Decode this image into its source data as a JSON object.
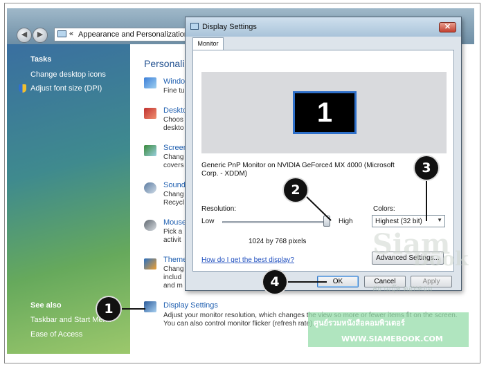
{
  "window": {
    "breadcrumb_chevron": "«",
    "breadcrumb": "Appearance and Personalization"
  },
  "sidebar": {
    "tasks_heading": "Tasks",
    "tasks": [
      "Change desktop icons",
      "Adjust font size (DPI)"
    ],
    "see_also_heading": "See also",
    "see_also": [
      "Taskbar and Start Menu",
      "Ease of Access"
    ]
  },
  "content": {
    "heading": "Personaliz",
    "items": [
      {
        "title": "Windo",
        "desc": [
          "Fine tu"
        ]
      },
      {
        "title": "Deskto",
        "desc": [
          "Choos",
          "deskto"
        ]
      },
      {
        "title": "Screen",
        "desc": [
          "Chang",
          "covers"
        ]
      },
      {
        "title": "Sound",
        "desc": [
          "Chang",
          "Recycl"
        ]
      },
      {
        "title": "Mouse",
        "desc": [
          "Pick a",
          "activit"
        ]
      },
      {
        "title": "Theme",
        "desc": [
          "Chang",
          "includ",
          "and m"
        ]
      }
    ],
    "display_settings": {
      "title": "Display Settings",
      "desc": [
        "Adjust your monitor resolution, which changes the view so more or fewer items fit on the screen.",
        "You can also control monitor flicker (refresh rate)."
      ]
    }
  },
  "dialog": {
    "title": "Display Settings",
    "close_glyph": "✕",
    "tab": "Monitor",
    "monitor_number": "1",
    "monitor_desc": "Generic PnP Monitor on NVIDIA GeForce4 MX 4000 (Microsoft Corp. - XDDM)",
    "resolution_label": "Resolution:",
    "low_label": "Low",
    "high_label": "High",
    "resolution_value": "1024 by 768 pixels",
    "colors_label": "Colors:",
    "colors_value": "Highest (32 bit)",
    "dropdown_arrow": "▼",
    "help_link": "How do I get the best display?",
    "advanced_button": "Advanced Settings...",
    "ok_button": "OK",
    "cancel_button": "Cancel",
    "apply_button": "Apply"
  },
  "callouts": [
    "1",
    "2",
    "3",
    "4"
  ],
  "watermark": {
    "line1": "Siam",
    "line2": "Book",
    "thai": "สยามบุ๊ค ดอทคอม",
    "banner_thai": "ศูนย์รวมหนังสือคอมพิวเตอร์",
    "url": "WWW.SIAMEBOOK.COM"
  },
  "colors": {
    "sidebar_gradient_start": "#3a6fa0",
    "sidebar_gradient_end": "#9cc86c",
    "link_blue": "#1f5fb0",
    "callout_black": "#111111"
  }
}
